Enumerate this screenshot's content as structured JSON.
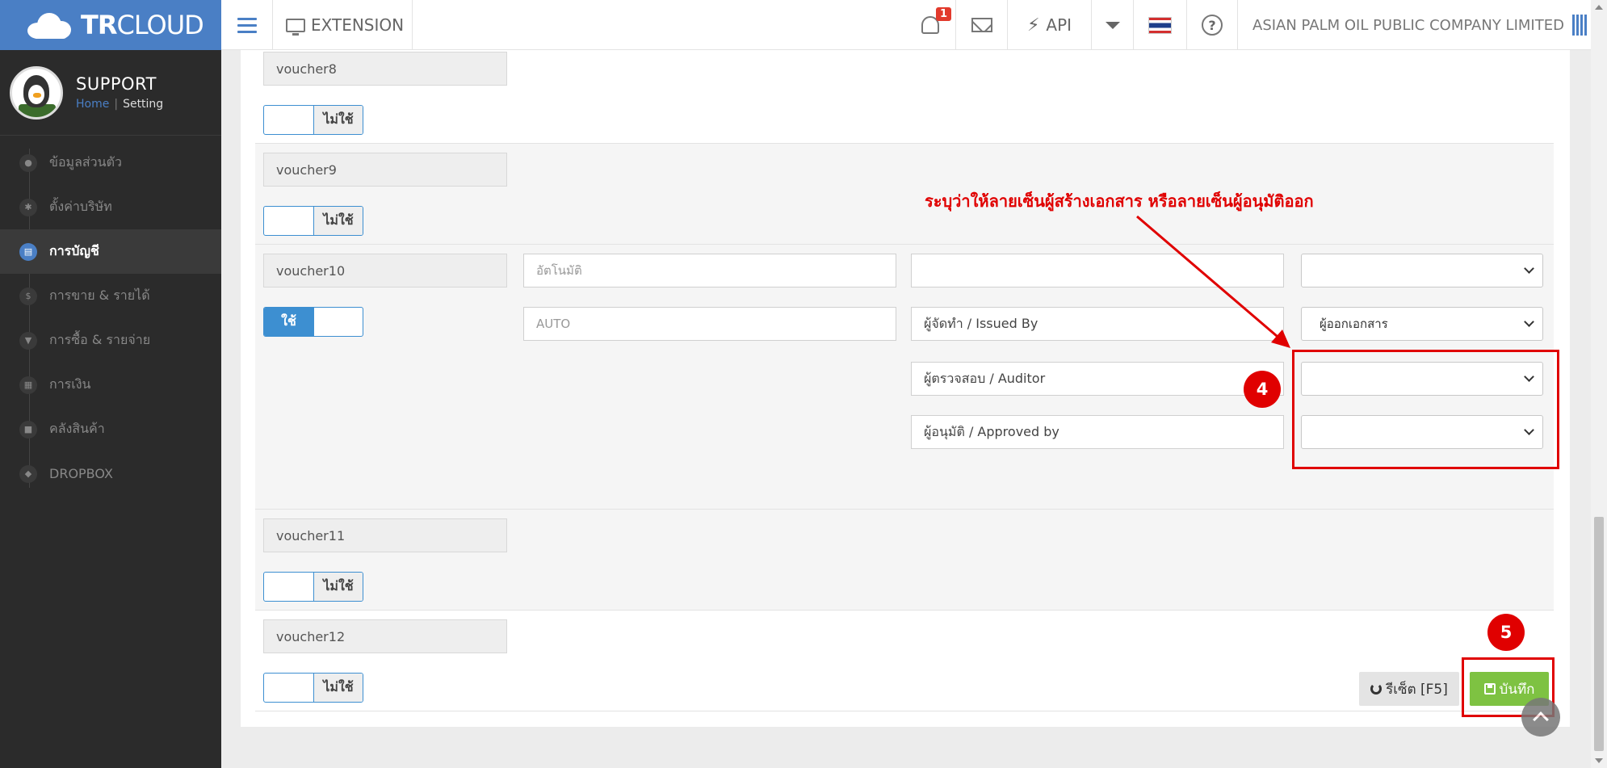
{
  "brand": {
    "bold": "TR",
    "rest": "CLOUD"
  },
  "topbar": {
    "extension": "EXTENSION",
    "notif_count": "1",
    "api": "API",
    "company": "ASIAN PALM OIL PUBLIC COMPANY LIMITED"
  },
  "user": {
    "name": "SUPPORT",
    "crumb_home": "Home",
    "crumb_sep": "|",
    "crumb_current": "Setting"
  },
  "menu": [
    {
      "label": "ข้อมูลส่วนตัว",
      "icon": "user-icon",
      "glyph": "●"
    },
    {
      "label": "ตั้งค่าบริษัท",
      "icon": "gear-icon",
      "glyph": "✱"
    },
    {
      "label": "การบัญชี",
      "icon": "book-icon",
      "glyph": "▤"
    },
    {
      "label": "การขาย & รายได้",
      "icon": "dollar-icon",
      "glyph": "$"
    },
    {
      "label": "การซื้อ & รายจ่าย",
      "icon": "cart-icon",
      "glyph": "▼"
    },
    {
      "label": "การเงิน",
      "icon": "calendar-icon",
      "glyph": "▦"
    },
    {
      "label": "คลังสินค้า",
      "icon": "truck-icon",
      "glyph": "■"
    },
    {
      "label": "DROPBOX",
      "icon": "dropbox-icon",
      "glyph": "◆"
    }
  ],
  "vouchers": {
    "v8": {
      "label": "voucher8",
      "toggle": "ไม่ใช้"
    },
    "v9": {
      "label": "voucher9",
      "toggle": "ไม่ใช้"
    },
    "v10": {
      "label": "voucher10",
      "toggle": "ใช้",
      "name_placeholder": "อัตโนมัติ",
      "code_placeholder": "AUTO",
      "field3_value": "",
      "issued_by": "ผู้จัดทำ / Issued By",
      "issued_select": "ผู้ออกเอกสาร",
      "auditor": "ผู้ตรวจสอบ / Auditor",
      "auditor_select": "",
      "approved": "ผู้อนุมัติ / Approved by",
      "approved_select": "",
      "top_select": ""
    },
    "v11": {
      "label": "voucher11",
      "toggle": "ไม่ใช้"
    },
    "v12": {
      "label": "voucher12",
      "toggle": "ไม่ใช้"
    }
  },
  "buttons": {
    "reset": "รีเซ็ต [F5]",
    "save": "บันทึก"
  },
  "annotations": {
    "note": "ระบุว่าให้ลายเซ็นผู้สร้างเอกสาร หรือลายเซ็นผู้อนุมัติออก",
    "step4": "4",
    "step5": "5"
  },
  "colors": {
    "brand_blue": "#4a7fc5",
    "annotation_red": "#e00000",
    "save_green": "#7ec242",
    "toggle_blue": "#3d8fd1"
  }
}
